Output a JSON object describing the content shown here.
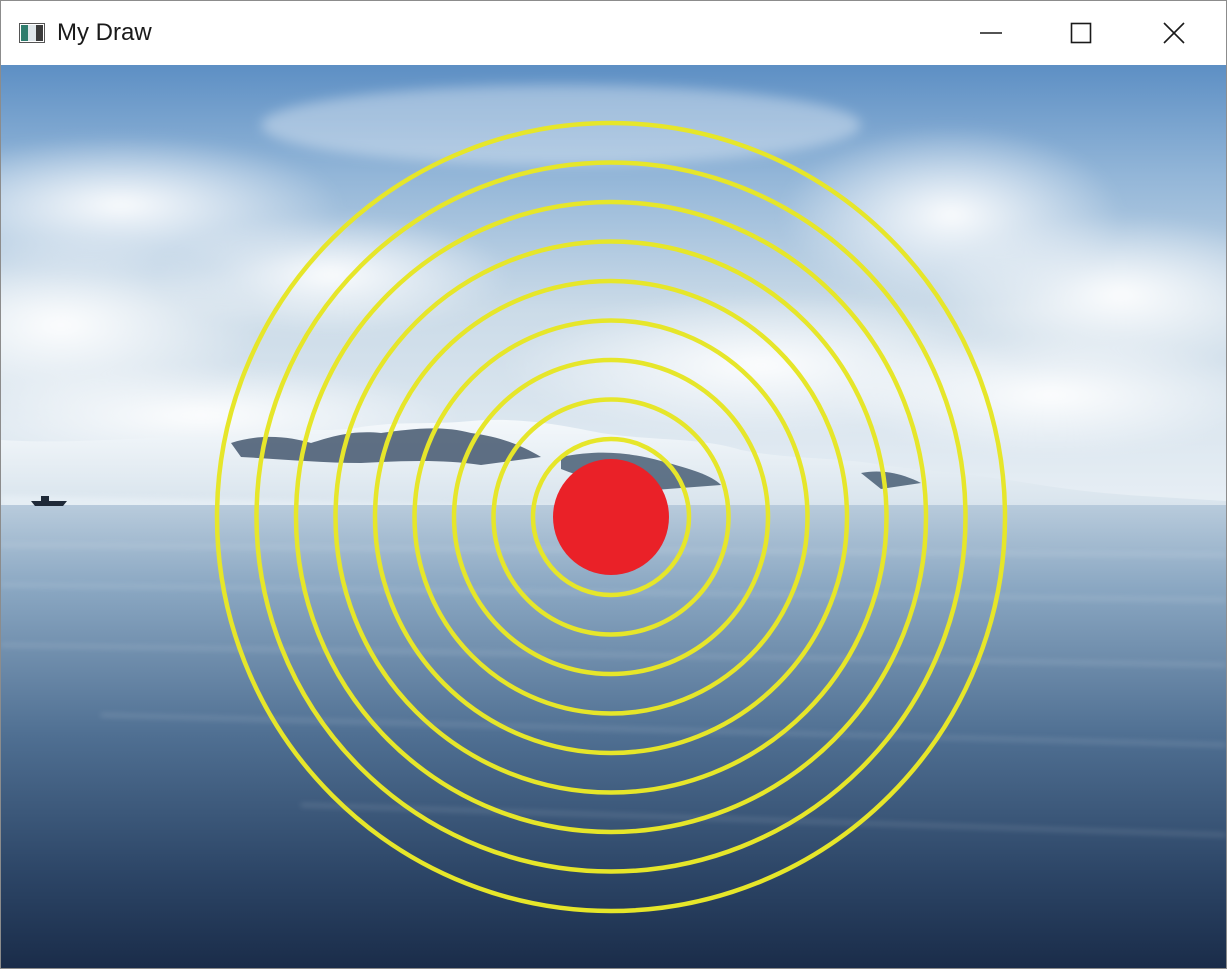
{
  "window": {
    "title": "My Draw",
    "app_icon": "app-window-icon",
    "controls": {
      "minimize_icon": "minimize-icon",
      "maximize_icon": "maximize-icon",
      "close_icon": "close-icon"
    }
  },
  "canvas": {
    "background_image": "arctic-lake-glacier-photo",
    "ring_color": "#e6e62a",
    "ring_count": 9,
    "center_dot_color": "#ea2128"
  }
}
